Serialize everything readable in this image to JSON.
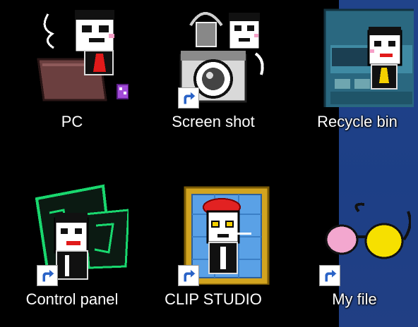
{
  "desktop": {
    "wallpaper_color": "#1f3f86",
    "background_color": "#000000",
    "label_color": "#ffffff",
    "icons": [
      {
        "label": "PC",
        "art": "spamton-laptop-icon",
        "shortcut": false
      },
      {
        "label": "Screen shot",
        "art": "spamton-camera-icon",
        "shortcut": true
      },
      {
        "label": "Recycle bin",
        "art": "spamton-dumpster-icon",
        "shortcut": false
      },
      {
        "label": "Control panel",
        "art": "spamton-circuit-panel-icon",
        "shortcut": true
      },
      {
        "label": "CLIP STUDIO",
        "art": "spamton-portrait-frame-icon",
        "shortcut": true
      },
      {
        "label": "My file",
        "art": "spamton-glasses-icon",
        "shortcut": true
      }
    ]
  }
}
